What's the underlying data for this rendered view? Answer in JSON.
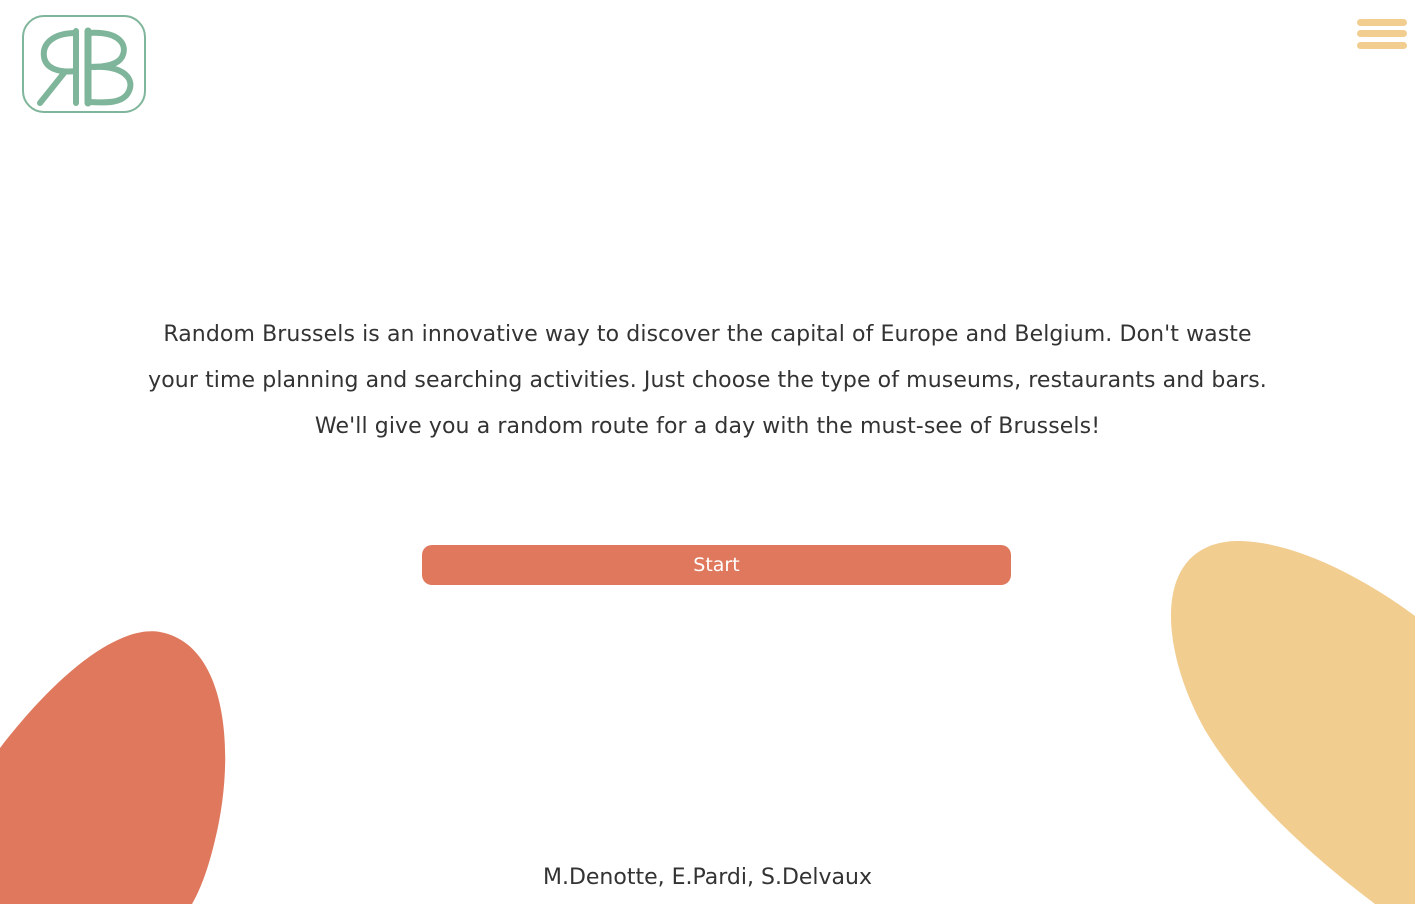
{
  "brand": {
    "logo_letters": "RB",
    "logo_color": "#7fb59a"
  },
  "menu": {
    "icon": "hamburger-menu-icon",
    "color": "#f2cd90"
  },
  "intro": {
    "line1": "Random Brussels is an innovative way to discover the capital of Europe and Belgium. Don't waste",
    "line2": "your time planning and searching activities. Just choose the type of museums, restaurants and bars.",
    "line3": "We'll give you a random route for a day with the must-see of Brussels!"
  },
  "actions": {
    "start_label": "Start",
    "start_color": "#df785d"
  },
  "decor": {
    "left_blob_color": "#df785d",
    "right_blob_color": "#f2cd90"
  },
  "footer": {
    "credits": "M.Denotte, E.Pardi, S.Delvaux"
  }
}
